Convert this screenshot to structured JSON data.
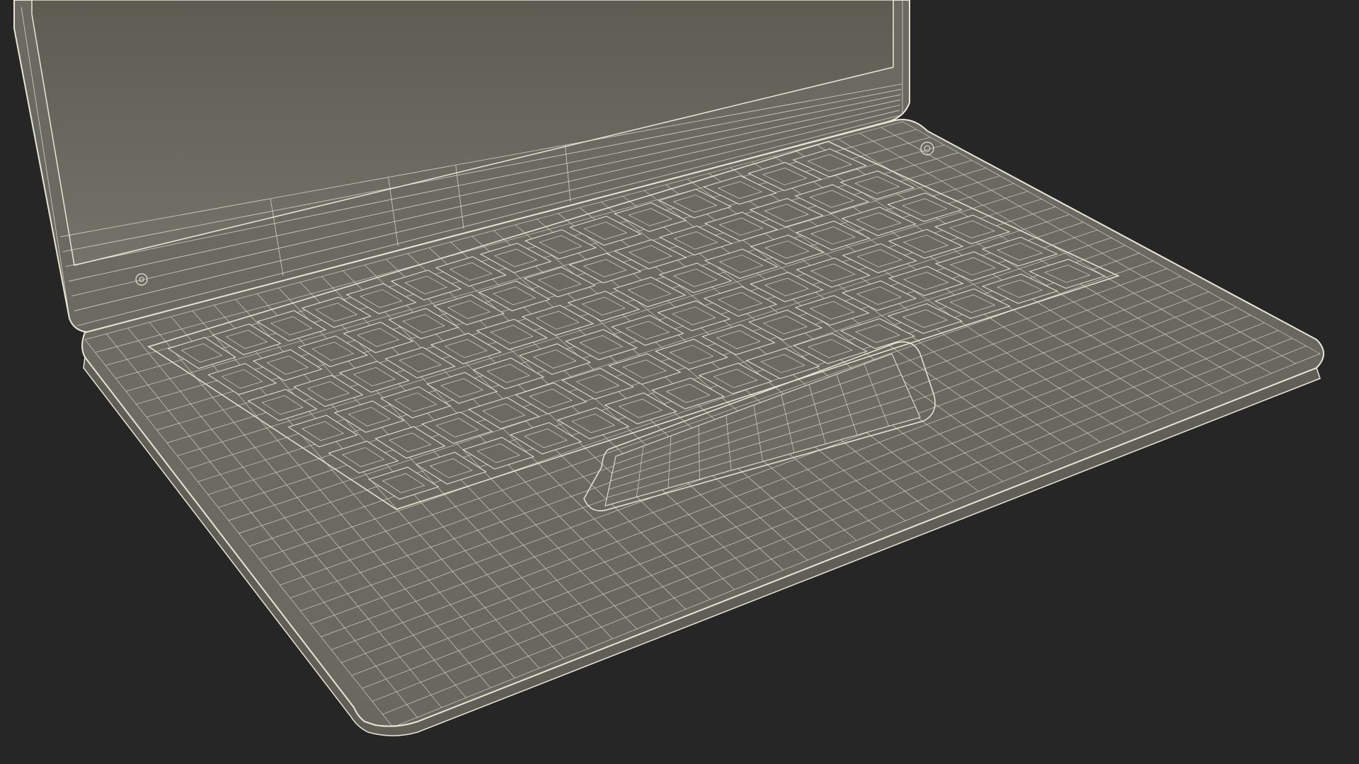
{
  "scene": {
    "subject": "laptop-wireframe-render",
    "colors": {
      "background": "#262626",
      "mesh_fill": "#6d6d64",
      "mesh_fill_dark": "#5f5f57",
      "screen_fill_top": "#5c5c53",
      "screen_fill_bottom": "#73736a",
      "wire": "#e9e7d4",
      "wire_dim": "#cfcdb9"
    }
  }
}
